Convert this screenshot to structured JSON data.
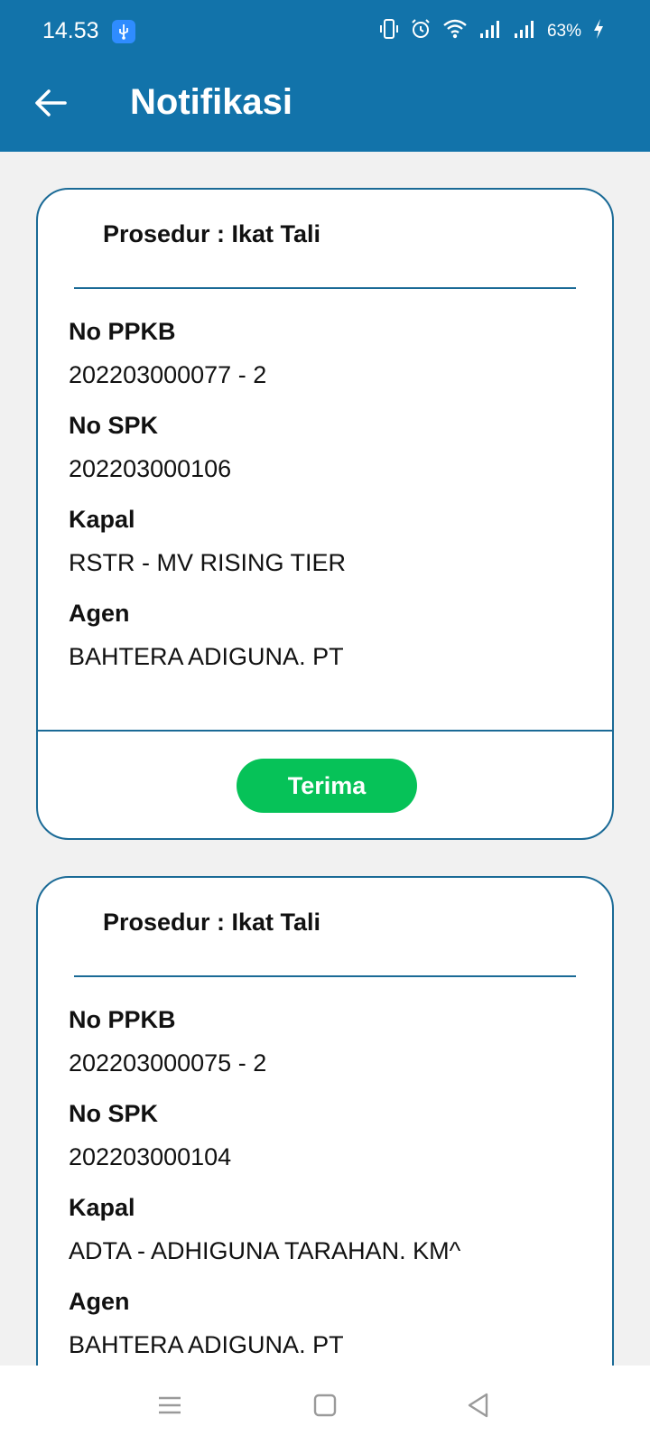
{
  "status_bar": {
    "time": "14.53",
    "battery_percent": "63%",
    "icons": [
      "usb-icon",
      "vibrate-icon",
      "alarm-icon",
      "wifi-icon",
      "signal-icon",
      "signal-icon",
      "charging-icon"
    ]
  },
  "header": {
    "title": "Notifikasi",
    "back_icon": "arrow-left-icon"
  },
  "notifications": [
    {
      "procedure": "Prosedur : Ikat Tali",
      "fields": [
        {
          "label": "No PPKB",
          "value": "202203000077 - 2"
        },
        {
          "label": "No SPK",
          "value": "202203000106"
        },
        {
          "label": "Kapal",
          "value": "RSTR - MV RISING TIER"
        },
        {
          "label": "Agen",
          "value": "BAHTERA ADIGUNA. PT"
        }
      ],
      "button_label": "Terima"
    },
    {
      "procedure": "Prosedur : Ikat Tali",
      "fields": [
        {
          "label": "No PPKB",
          "value": "202203000075 - 2"
        },
        {
          "label": "No SPK",
          "value": "202203000104"
        },
        {
          "label": "Kapal",
          "value": "ADTA - ADHIGUNA TARAHAN. KM^"
        },
        {
          "label": "Agen",
          "value": "BAHTERA ADIGUNA. PT"
        }
      ]
    }
  ],
  "colors": {
    "app_bar": "#1273aa",
    "card_border": "#1a6a96",
    "accept_button": "#06c258",
    "background": "#f1f1f1"
  },
  "nav_bar": {
    "icons": [
      "menu-icon",
      "home-square-icon",
      "back-triangle-icon"
    ]
  }
}
